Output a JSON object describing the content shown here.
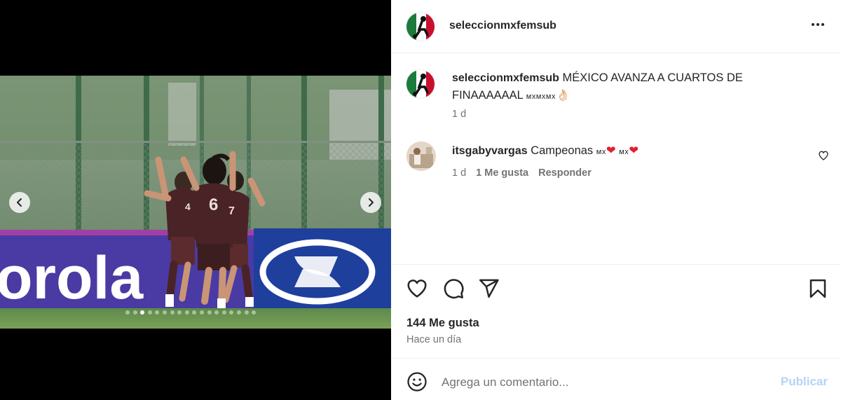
{
  "post": {
    "username": "seleccionmxfemsub",
    "more_icon": "more-horizontal-icon"
  },
  "media": {
    "prev_icon": "chevron-left-icon",
    "next_icon": "chevron-right-icon",
    "carousel_count": 18,
    "carousel_active_index": 2,
    "ad_text": "orola",
    "jersey_numbers": [
      "6",
      "7",
      "4"
    ],
    "colors": {
      "ad_board": "#4a3aa3",
      "hyundai_board": "#1f3f9c",
      "kit": "#4a2326"
    }
  },
  "caption": {
    "username": "seleccionmxfemsub",
    "text": "MÉXICO AVANZA A CUARTOS DE FINAAAAAAL",
    "flags": "ᴍхᴍхᴍх",
    "emoji": "👌🏻",
    "time": "1 d"
  },
  "comment": {
    "username": "itsgabyvargas",
    "text": "Campeonas",
    "flag": "ᴍх",
    "time": "1 d",
    "likes": "1 Me gusta",
    "reply": "Responder"
  },
  "actions": {
    "likes_count": "144 Me gusta",
    "date": "Hace un día"
  },
  "composer": {
    "placeholder": "Agrega un comentario...",
    "publish": "Publicar"
  },
  "colors": {
    "text": "#262626",
    "secondary": "#737373",
    "publish_disabled": "#b3d4f7",
    "heart": "#e0202f",
    "border": "#efefef"
  }
}
